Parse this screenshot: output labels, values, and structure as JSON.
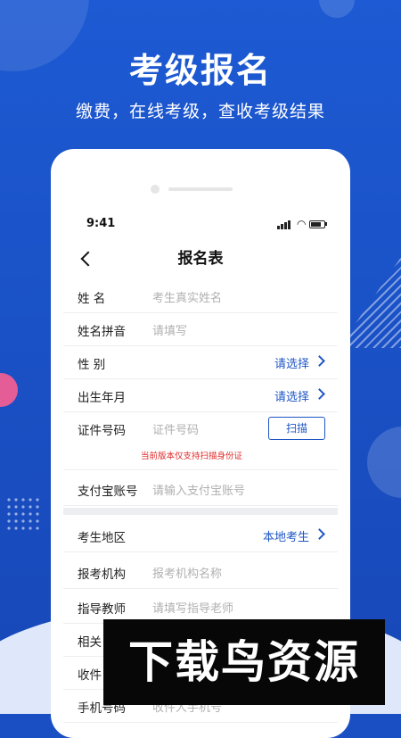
{
  "header": {
    "title": "考级报名",
    "subtitle": "缴费，在线考级，查收考级结果"
  },
  "status_bar": {
    "time": "9:41"
  },
  "nav": {
    "title": "报名表"
  },
  "form": {
    "name": {
      "label": "姓 名",
      "placeholder": "考生真实姓名"
    },
    "pinyin": {
      "label": "姓名拼音",
      "placeholder": "请填写"
    },
    "gender": {
      "label": "性 别",
      "value": "请选择"
    },
    "birth": {
      "label": "出生年月",
      "value": "请选择"
    },
    "id": {
      "label": "证件号码",
      "placeholder": "证件号码",
      "scan_label": "扫描",
      "note": "当前版本仅支持扫描身份证"
    },
    "alipay": {
      "label": "支付宝账号",
      "placeholder": "请输入支付宝账号"
    },
    "region": {
      "label": "考生地区",
      "value": "本地考生"
    },
    "org": {
      "label": "报考机构",
      "placeholder": "报考机构名称"
    },
    "teacher": {
      "label": "指导教师",
      "placeholder": "请填写指导老师"
    },
    "related": {
      "label": "相关"
    },
    "receiver": {
      "label": "收件"
    },
    "phone": {
      "label": "手机号码",
      "placeholder": "收件人手机号"
    }
  },
  "watermark": {
    "text": "下载鸟资源"
  },
  "colors": {
    "brand_blue": "#1d5ad3",
    "link_blue": "#1f56c4",
    "warning_red": "#e02a2a"
  }
}
